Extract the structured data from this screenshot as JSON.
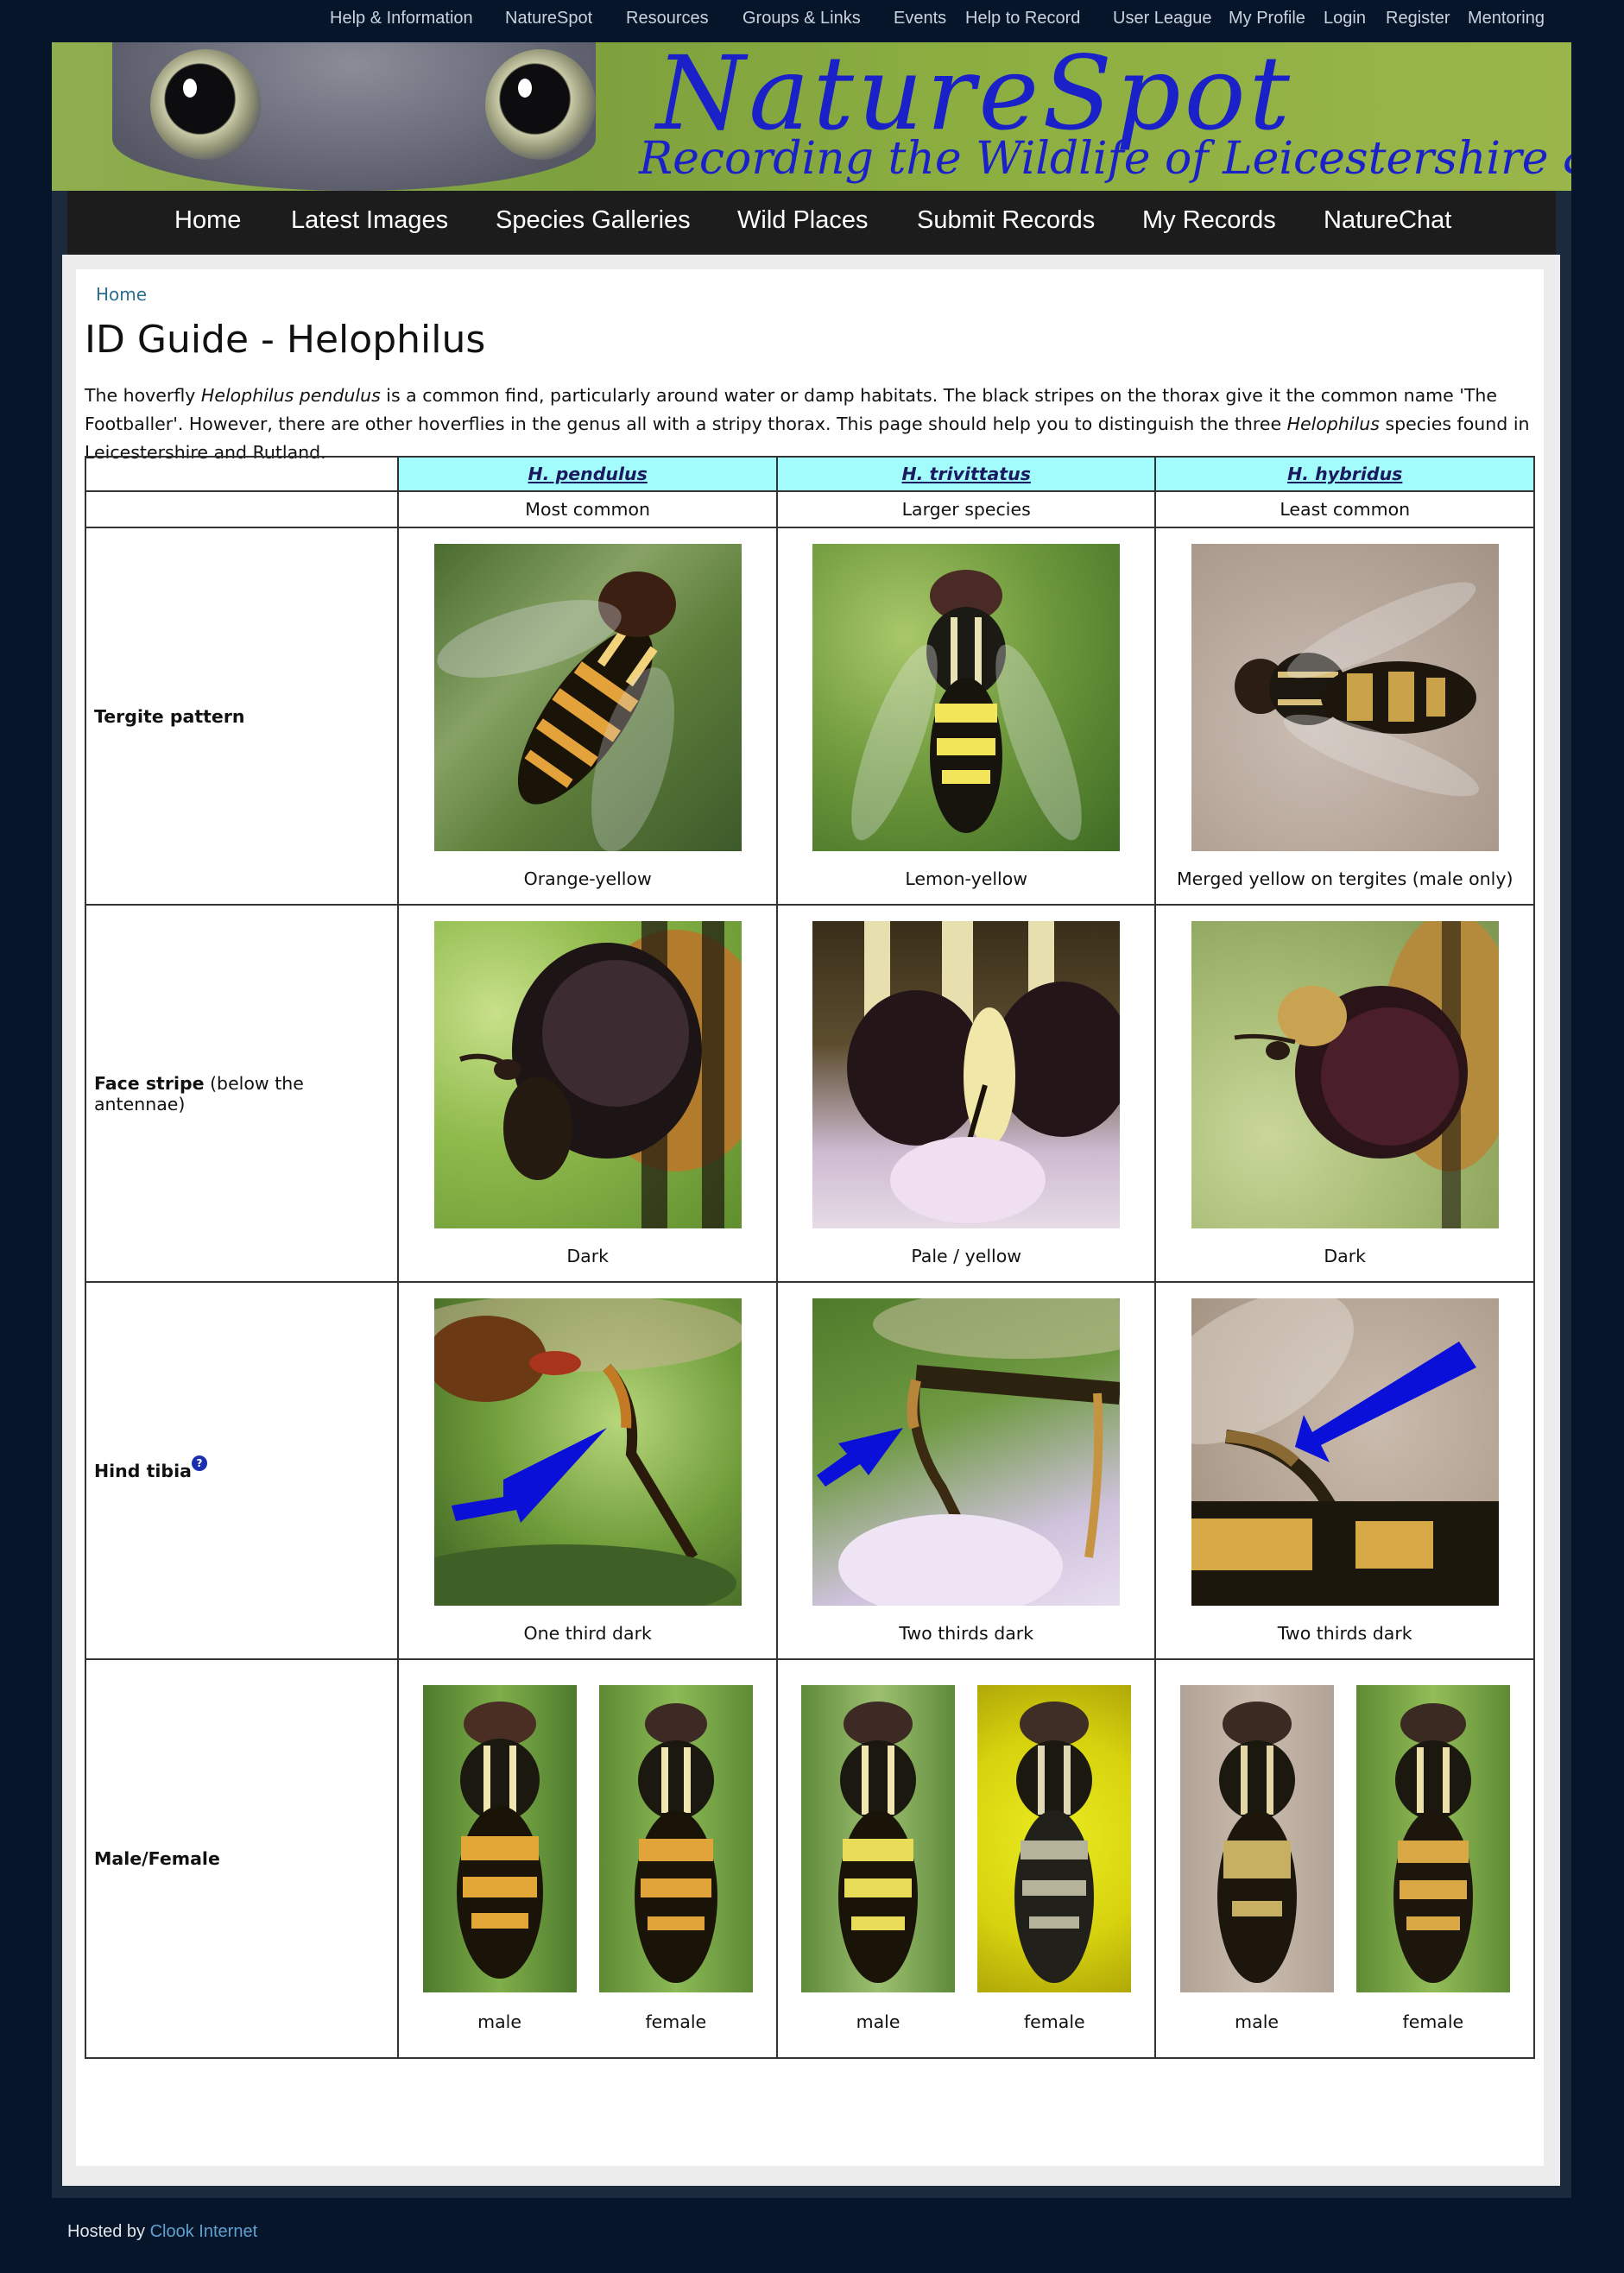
{
  "top_nav": [
    {
      "label": "Help & Information"
    },
    {
      "label": "NatureSpot"
    },
    {
      "label": "Resources"
    },
    {
      "label": "Groups & Links"
    },
    {
      "label": "Events"
    },
    {
      "label": "Help to Record"
    },
    {
      "label": "User League"
    },
    {
      "label": "My Profile"
    },
    {
      "label": "Login"
    },
    {
      "label": "Register"
    },
    {
      "label": "Mentoring"
    }
  ],
  "banner": {
    "title": "NatureSpot",
    "subtitle": "Recording the Wildlife of Leicestershire & Rutland"
  },
  "main_nav": [
    {
      "label": "Home"
    },
    {
      "label": "Latest Images"
    },
    {
      "label": "Species Galleries"
    },
    {
      "label": "Wild Places"
    },
    {
      "label": "Submit Records"
    },
    {
      "label": "My Records"
    },
    {
      "label": "NatureChat"
    }
  ],
  "breadcrumb": "Home",
  "page_title": "ID Guide - Helophilus",
  "intro": {
    "p1": "The hoverfly ",
    "species": "Helophilus pendulus",
    "p2": " is a common find, particularly around water or damp habitats. The black stripes on the thorax give it the common name 'The Footballer'. However, there are other hoverflies in the genus all with a stripy thorax. This page should help you to distinguish the three ",
    "genus": "Helophilus",
    "p3": " species found in Leicestershire and Rutland."
  },
  "table": {
    "species": [
      {
        "name": "H. pendulus",
        "note": "Most common"
      },
      {
        "name": "H. trivittatus",
        "note": "Larger species"
      },
      {
        "name": "H. hybridus",
        "note": "Least common"
      }
    ],
    "rows": [
      {
        "label": "Tergite pattern",
        "label_extra": "",
        "captions": [
          "Orange-yellow",
          "Lemon-yellow",
          "Merged yellow on tergites (male only)"
        ]
      },
      {
        "label": "Face stripe",
        "label_extra": " (below the antennae)",
        "captions": [
          "Dark",
          "Pale / yellow",
          "Dark"
        ]
      },
      {
        "label": "Hind tibia",
        "label_extra": "",
        "help": "?",
        "captions": [
          "One third dark",
          "Two thirds dark",
          "Two thirds dark"
        ]
      }
    ],
    "male_female": {
      "label": "Male/Female",
      "captions": [
        "male",
        "female",
        "male",
        "female",
        "male",
        "female"
      ]
    }
  },
  "footer": {
    "prefix": "Hosted by ",
    "link": "Clook Internet"
  },
  "colors": {
    "background": "#07152a",
    "header_cell": "#a3fcfc",
    "link": "#2b6d8f",
    "logo": "#1a21c8"
  }
}
